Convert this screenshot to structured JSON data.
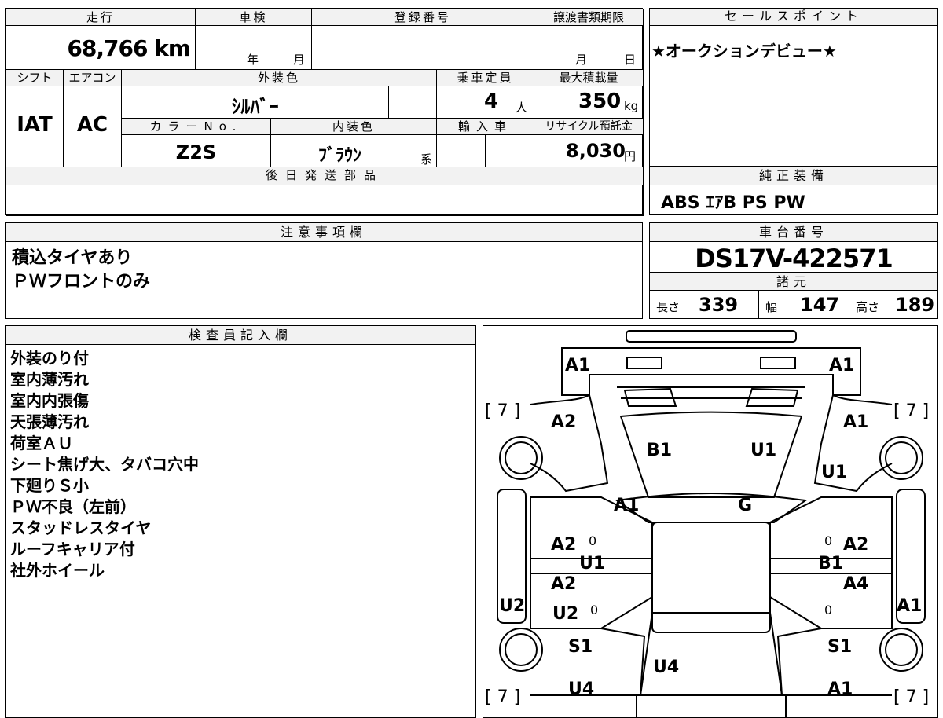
{
  "specs": {
    "mileage_label": "走行",
    "mileage_value": "68,766 km",
    "shaken_label": "車検",
    "shaken_year_unit": "年",
    "shaken_month_unit": "月",
    "registration_label": "登録番号",
    "transfer_deadline_label": "譲渡書類期限",
    "transfer_month_unit": "月",
    "transfer_day_unit": "日",
    "shift_label": "シフト",
    "shift_value": "IAT",
    "aircon_label": "エアコン",
    "aircon_value": "AC",
    "exterior_color_label": "外装色",
    "exterior_color_value": "ｼﾙﾊﾞｰ",
    "color_no_label": "カラーNo.",
    "color_no_value": "Z2S",
    "interior_color_label": "内装色",
    "interior_color_value": "ﾌﾞﾗｳﾝ",
    "interior_color_suffix": "系",
    "capacity_label": "乗車定員",
    "capacity_value": "4",
    "capacity_unit": "人",
    "max_load_label": "最大積載量",
    "max_load_value": "350",
    "max_load_unit": "kg",
    "import_label": "輸入車",
    "recycle_label": "リサイクル預託金",
    "recycle_value": "8,030",
    "recycle_unit": "円",
    "later_parts_label": "後日発送部品"
  },
  "sales_point": {
    "label": "セールスポイント",
    "text": "★オークションデビュー★"
  },
  "genuine_equipment": {
    "label": "純正装備",
    "text": "ABS ｴｱB PS PW"
  },
  "caution": {
    "label": "注意事項欄",
    "lines": [
      "積込タイヤあり",
      "ＰＷフロントのみ"
    ]
  },
  "chassis": {
    "label": "車台番号",
    "value": "DS17V-422571"
  },
  "dimensions": {
    "label": "諸元",
    "length_label": "長さ",
    "length_value": "339",
    "width_label": "幅",
    "width_value": "147",
    "height_label": "高さ",
    "height_value": "189"
  },
  "inspector": {
    "label": "検査員記入欄",
    "lines": [
      "外装のり付",
      "室内薄汚れ",
      "室内内張傷",
      "天張薄汚れ",
      "荷室ＡＵ",
      "シート焦げ大、タバコ穴中",
      "下廻りＳ小",
      "ＰＷ不良（左前）",
      "スタッドレスタイヤ",
      "ルーフキャリア付",
      "社外ホイール"
    ]
  },
  "diagram": {
    "tire_tread_top_left": "[ 7 ]",
    "tire_tread_top_right": "[ 7 ]",
    "tire_tread_bottom_left": "[ 7 ]",
    "tire_tread_bottom_right": "[ 7 ]",
    "marks": {
      "front_left": "A1",
      "front_right": "A1",
      "fender_left": "A2",
      "fender_right": "A1",
      "hood_left": "B1",
      "hood_right": "U1",
      "fender_right_lower": "U1",
      "windshield_left": "A1",
      "windshield_right": "G",
      "door_front_left": "A2",
      "door_front_right": "A2",
      "door_front_left_2": "U1",
      "door_front_right_2": "B1",
      "door_rear_left": "A2",
      "door_rear_right": "A4",
      "door_rear_left_2": "U2",
      "sill_left": "U2",
      "sill_right": "A1",
      "quarter_left": "S1",
      "quarter_right": "S1",
      "back_door": "U4",
      "rear_left": "U4",
      "rear_right": "A1"
    },
    "zero_mark": "0"
  }
}
